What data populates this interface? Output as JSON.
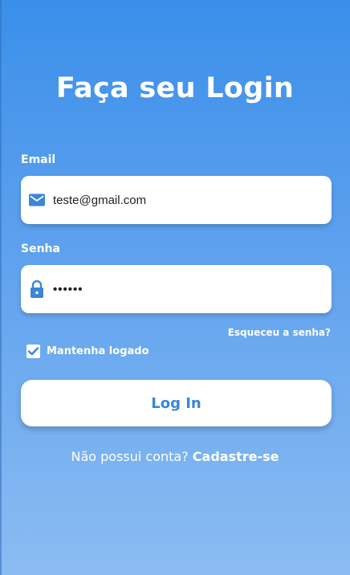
{
  "page": {
    "title": "Faça seu Login"
  },
  "form": {
    "email": {
      "label": "Email",
      "value": "teste@gmail.com",
      "icon": "mail-icon"
    },
    "password": {
      "label": "Senha",
      "value": "••••••",
      "icon": "lock-icon"
    },
    "forgot_label": "Esqueceu a senha?",
    "remember": {
      "label": "Mantenha logado",
      "checked": true
    },
    "login_label": "Log In"
  },
  "signup": {
    "prompt": "Não possui conta?",
    "link_label": "Cadastre-se"
  },
  "colors": {
    "background_top": "#3a8fea",
    "background_bottom": "#8bbcf2",
    "accent": "#3a86d8",
    "field_bg": "#ffffff"
  }
}
